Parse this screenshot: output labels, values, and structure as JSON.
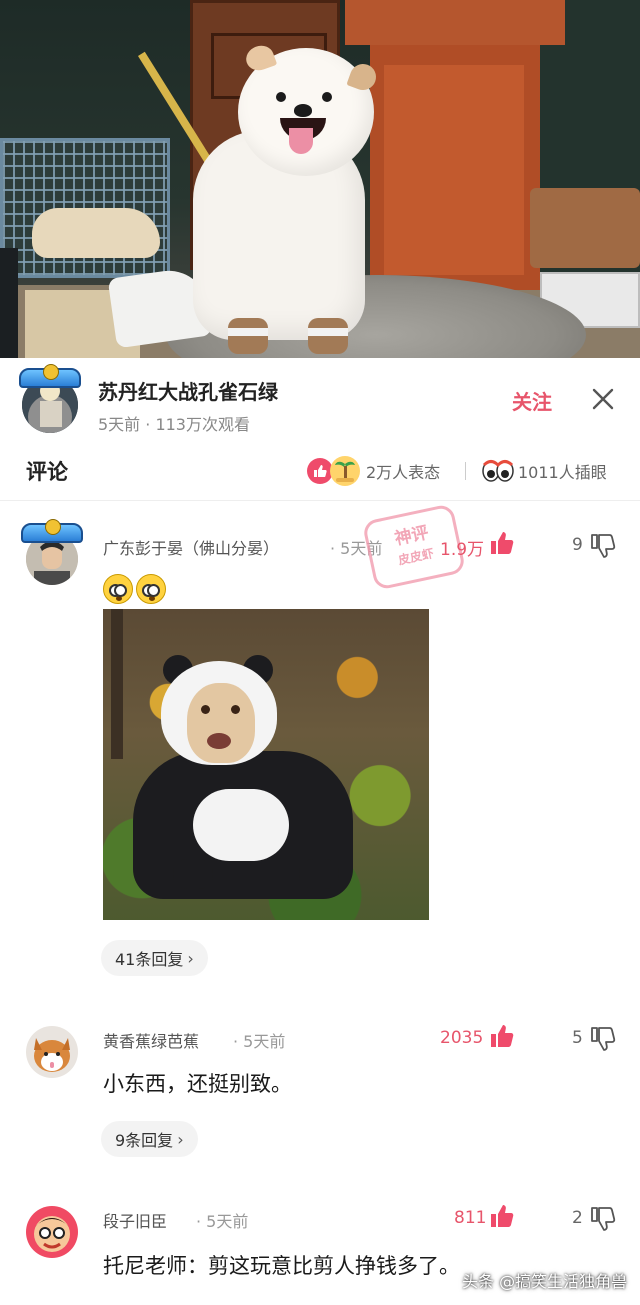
{
  "author": {
    "name": "苏丹红大战孔雀石绿",
    "meta": "5天前 · 113万次观看",
    "follow_label": "关注"
  },
  "comment_bar": {
    "title": "评论",
    "reactions_text": "2万人表态",
    "eyes_text": "1011人插眼"
  },
  "comments": [
    {
      "name": "广东彭于晏（佛山分晏）",
      "time": "· 5天前",
      "likes": "1.9万",
      "dislikes": "9",
      "stamp_line1": "神评",
      "stamp_line2": "皮皮虾",
      "reply_label": "41条回复"
    },
    {
      "name": "黄香蕉绿芭蕉",
      "time": "· 5天前",
      "likes": "2035",
      "dislikes": "5",
      "text": "小东西，还挺别致。",
      "reply_label": "9条回复"
    },
    {
      "name": "段子旧臣",
      "time": "· 5天前",
      "likes": "811",
      "dislikes": "2",
      "text": "托尼老师：剪这玩意比剪人挣钱多了。"
    }
  ],
  "watermark": "头条 @搞笑生活独角兽",
  "colors": {
    "accent": "#e7556b",
    "muted": "#999999",
    "pill_bg": "#f3f3f3"
  },
  "icons": [
    "close-icon",
    "like-reaction-icon",
    "palm-reaction-icon",
    "eyes-icon",
    "thumb-up-icon",
    "thumb-down-icon",
    "chevron-right-icon",
    "dizzy-face-emoji-icon"
  ]
}
